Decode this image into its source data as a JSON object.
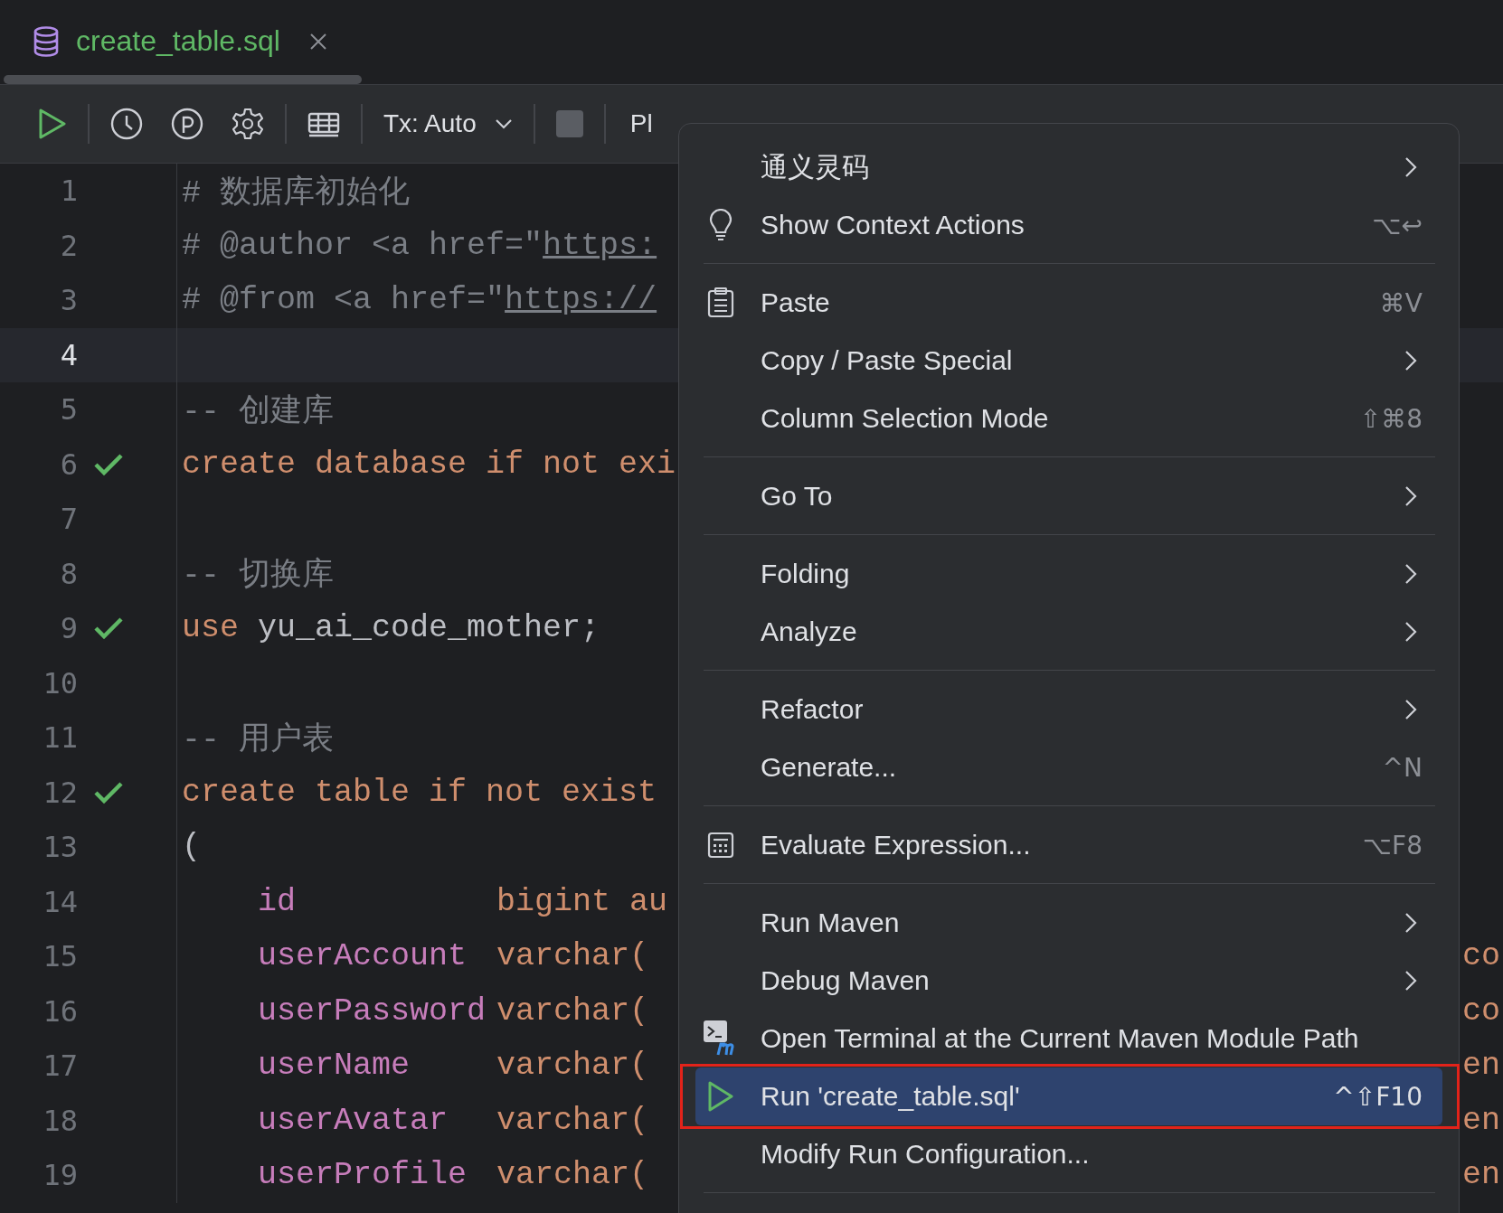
{
  "tab": {
    "title": "create_table.sql",
    "selected": true
  },
  "toolbar": {
    "transaction": "Tx: Auto",
    "console": "Pl"
  },
  "lines": [
    {
      "number": "1",
      "check": false,
      "current": false,
      "indent": false,
      "tokens": [
        {
          "kind": "comment",
          "text": "# 数据库初始化"
        }
      ]
    },
    {
      "number": "2",
      "check": false,
      "current": false,
      "indent": false,
      "tokens": [
        {
          "kind": "comment",
          "text": "# @author <a href=\""
        },
        {
          "kind": "link",
          "text": "https:"
        }
      ]
    },
    {
      "number": "3",
      "check": false,
      "current": false,
      "indent": false,
      "tokens": [
        {
          "kind": "comment",
          "text": "# @from <a href=\""
        },
        {
          "kind": "link",
          "text": "https://"
        }
      ]
    },
    {
      "number": "4",
      "check": false,
      "current": true,
      "indent": false
    },
    {
      "number": "5",
      "check": false,
      "current": false,
      "indent": false,
      "tokens": [
        {
          "kind": "comment",
          "text": "-- 创建库"
        }
      ]
    },
    {
      "number": "6",
      "check": true,
      "current": false,
      "indent": false,
      "tokens": [
        {
          "kind": "keyword",
          "text": "create database if not exi"
        }
      ]
    },
    {
      "number": "7",
      "check": false,
      "current": false,
      "indent": false
    },
    {
      "number": "8",
      "check": false,
      "current": false,
      "indent": false,
      "tokens": [
        {
          "kind": "comment",
          "text": "-- 切换库"
        }
      ]
    },
    {
      "number": "9",
      "check": true,
      "current": false,
      "indent": false,
      "tokens": [
        {
          "kind": "keyword",
          "text": "use"
        },
        {
          "kind": "plain",
          "text": "yu_ai_code_mother;"
        }
      ]
    },
    {
      "number": "10",
      "check": false,
      "current": false,
      "indent": false
    },
    {
      "number": "11",
      "check": false,
      "current": false,
      "indent": false,
      "tokens": [
        {
          "kind": "comment",
          "text": "-- 用户表"
        }
      ]
    },
    {
      "number": "12",
      "check": true,
      "current": false,
      "indent": false,
      "tokens": [
        {
          "kind": "keyword",
          "text": "create table if not exist"
        }
      ]
    },
    {
      "number": "13",
      "check": false,
      "current": false,
      "indent": false,
      "tokens": [
        {
          "kind": "plain",
          "text": "("
        }
      ]
    },
    {
      "number": "14",
      "check": false,
      "current": false,
      "indent": true,
      "tokens": [
        {
          "kind": "field",
          "text": "id"
        },
        {
          "kind": "keyword",
          "text": "bigint au"
        }
      ]
    },
    {
      "number": "15",
      "check": false,
      "current": false,
      "indent": true,
      "tokens": [
        {
          "kind": "field",
          "text": "userAccount"
        },
        {
          "kind": "keyword",
          "text": "varchar("
        }
      ],
      "tail": "co"
    },
    {
      "number": "16",
      "check": false,
      "current": false,
      "indent": true,
      "tokens": [
        {
          "kind": "field",
          "text": "userPassword"
        },
        {
          "kind": "keyword",
          "text": "varchar("
        }
      ],
      "tail": "co"
    },
    {
      "number": "17",
      "check": false,
      "current": false,
      "indent": true,
      "tokens": [
        {
          "kind": "field",
          "text": "userName"
        },
        {
          "kind": "keyword",
          "text": "varchar("
        }
      ],
      "tail": "en"
    },
    {
      "number": "18",
      "check": false,
      "current": false,
      "indent": true,
      "tokens": [
        {
          "kind": "field",
          "text": "userAvatar"
        },
        {
          "kind": "keyword",
          "text": "varchar("
        }
      ],
      "tail": "en"
    },
    {
      "number": "19",
      "check": false,
      "current": false,
      "indent": true,
      "tokens": [
        {
          "kind": "field",
          "text": "userProfile"
        },
        {
          "kind": "keyword",
          "text": "varchar("
        }
      ],
      "tail": "en"
    }
  ],
  "menu": [
    {
      "kind": "item",
      "label": "通义灵码",
      "submenu": true,
      "selected": false
    },
    {
      "kind": "item",
      "label": "Show Context Actions",
      "shortcut": "⌥↩",
      "submenu": false,
      "selected": false
    },
    {
      "kind": "separator"
    },
    {
      "kind": "item",
      "label": "Paste",
      "shortcut": "⌘V",
      "submenu": false,
      "selected": false
    },
    {
      "kind": "item",
      "label": "Copy / Paste Special",
      "submenu": true,
      "selected": false
    },
    {
      "kind": "item",
      "label": "Column Selection Mode",
      "shortcut": "⇧⌘8",
      "submenu": false,
      "selected": false
    },
    {
      "kind": "separator"
    },
    {
      "kind": "item",
      "label": "Go To",
      "submenu": true,
      "selected": false
    },
    {
      "kind": "separator"
    },
    {
      "kind": "item",
      "label": "Folding",
      "submenu": true,
      "selected": false
    },
    {
      "kind": "item",
      "label": "Analyze",
      "submenu": true,
      "selected": false
    },
    {
      "kind": "separator"
    },
    {
      "kind": "item",
      "label": "Refactor",
      "submenu": true,
      "selected": false
    },
    {
      "kind": "item",
      "label": "Generate...",
      "shortcut": "^N",
      "submenu": false,
      "selected": false
    },
    {
      "kind": "separator"
    },
    {
      "kind": "item",
      "label": "Evaluate Expression...",
      "shortcut": "⌥F8",
      "submenu": false,
      "selected": false
    },
    {
      "kind": "separator"
    },
    {
      "kind": "item",
      "label": "Run Maven",
      "submenu": true,
      "selected": false
    },
    {
      "kind": "item",
      "label": "Debug Maven",
      "submenu": true,
      "selected": false
    },
    {
      "kind": "item",
      "label": "Open Terminal at the Current Maven Module Path",
      "submenu": false,
      "selected": false
    },
    {
      "kind": "item",
      "label": "Run 'create_table.sql'",
      "shortcut": "^⇧F10",
      "submenu": false,
      "selected": true
    },
    {
      "kind": "item",
      "label": "Modify Run Configuration...",
      "submenu": false,
      "selected": false
    },
    {
      "kind": "separator"
    }
  ]
}
